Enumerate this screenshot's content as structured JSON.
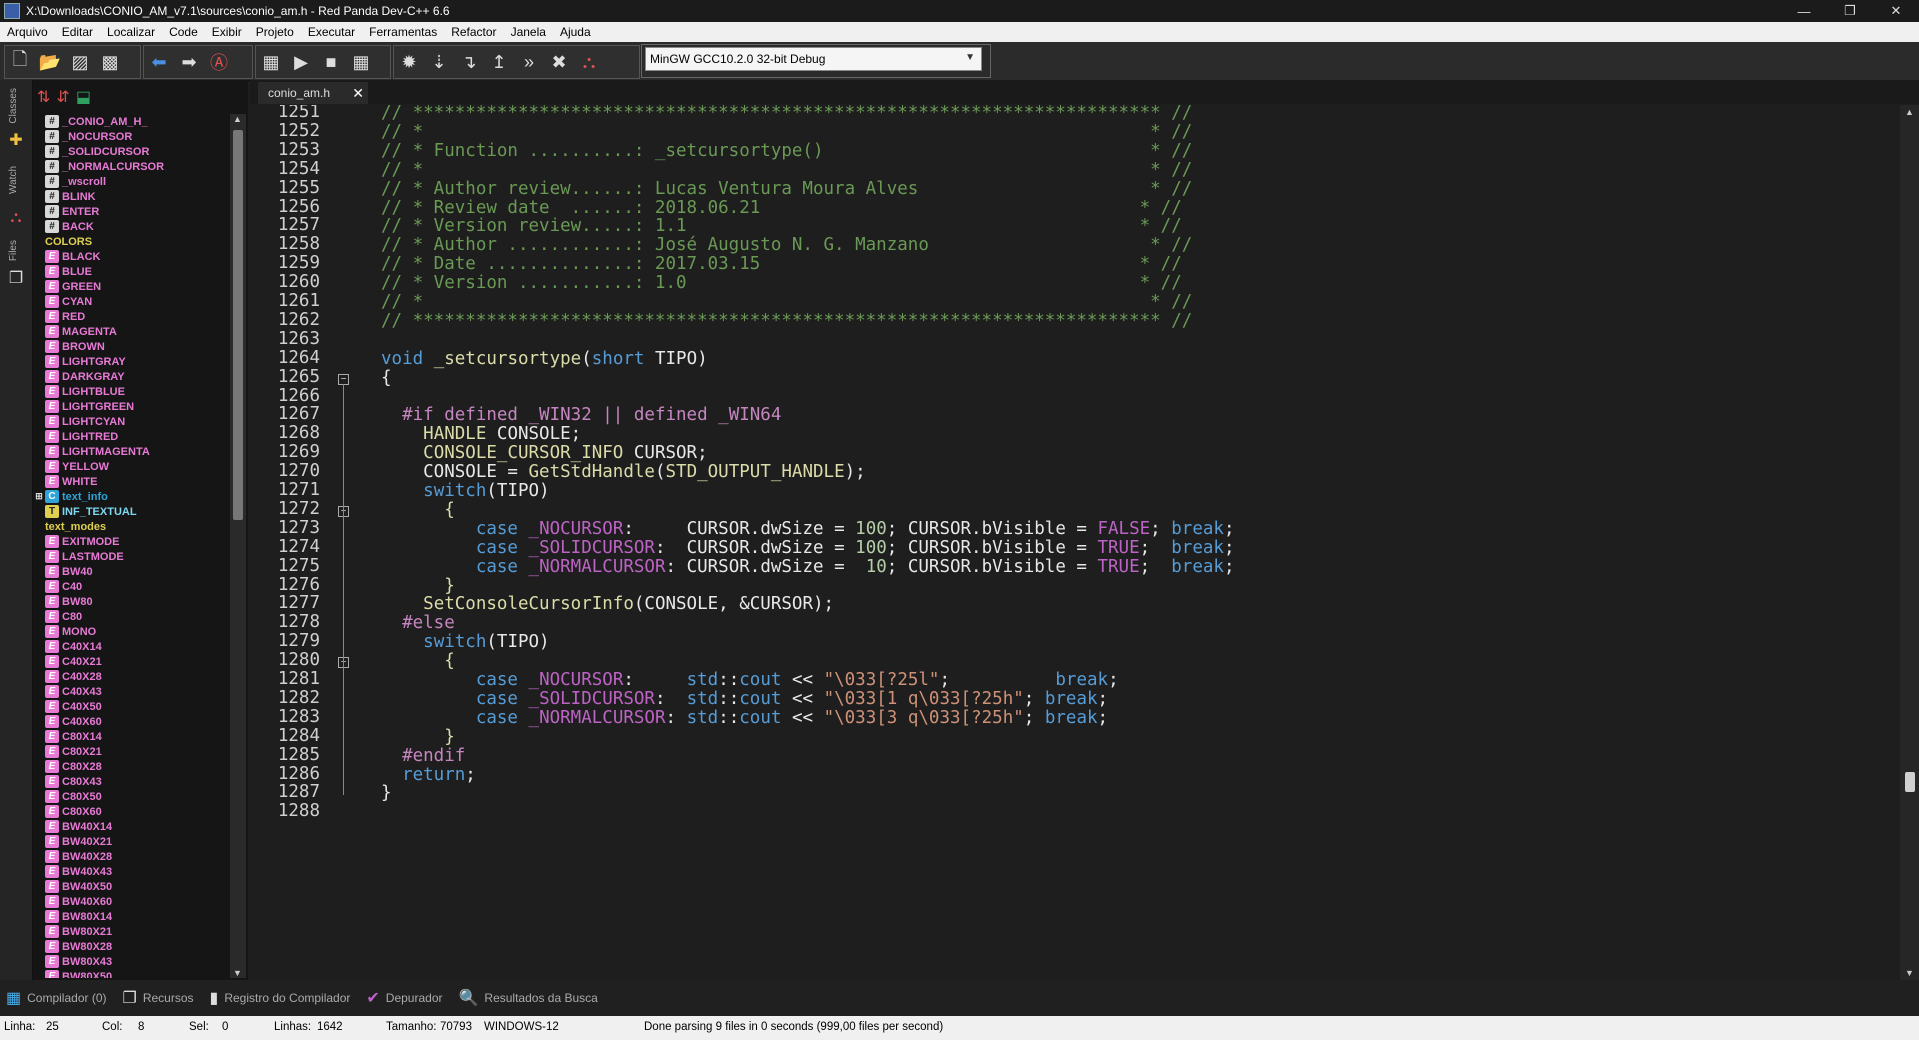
{
  "window": {
    "title": "X:\\Downloads\\CONIO_AM_v7.1\\sources\\conio_am.h - Red Panda Dev-C++ 6.6",
    "minimize": "—",
    "maximize": "❐",
    "close": "✕"
  },
  "menu": [
    "Arquivo",
    "Editar",
    "Localizar",
    "Code",
    "Exibir",
    "Projeto",
    "Executar",
    "Ferramentas",
    "Refactor",
    "Janela",
    "Ajuda"
  ],
  "compiler_select": {
    "value": "MinGW GCC10.2.0 32-bit Debug"
  },
  "side_tabs": {
    "classes": "Classes",
    "watch": "Watch",
    "files": "Files"
  },
  "tree_items": [
    {
      "label": "_CONIO_AM_H_",
      "icon": "hash",
      "color": "#e87ad6"
    },
    {
      "label": "_NOCURSOR",
      "icon": "hash",
      "color": "#e87ad6"
    },
    {
      "label": "_SOLIDCURSOR",
      "icon": "hash",
      "color": "#e87ad6"
    },
    {
      "label": "_NORMALCURSOR",
      "icon": "hash",
      "color": "#e87ad6"
    },
    {
      "label": "_wscroll",
      "icon": "hash",
      "color": "#e87ad6"
    },
    {
      "label": "BLINK",
      "icon": "hash",
      "color": "#e87ad6"
    },
    {
      "label": "ENTER",
      "icon": "hash",
      "color": "#e87ad6"
    },
    {
      "label": "BACK",
      "icon": "hash",
      "color": "#e87ad6"
    },
    {
      "label": "COLORS",
      "icon": "none",
      "color": "#e0d050"
    },
    {
      "label": "BLACK",
      "icon": "enum",
      "color": "#e87ad6"
    },
    {
      "label": "BLUE",
      "icon": "enum",
      "color": "#e87ad6"
    },
    {
      "label": "GREEN",
      "icon": "enum",
      "color": "#e87ad6"
    },
    {
      "label": "CYAN",
      "icon": "enum",
      "color": "#e87ad6"
    },
    {
      "label": "RED",
      "icon": "enum",
      "color": "#e87ad6"
    },
    {
      "label": "MAGENTA",
      "icon": "enum",
      "color": "#e87ad6"
    },
    {
      "label": "BROWN",
      "icon": "enum",
      "color": "#e87ad6"
    },
    {
      "label": "LIGHTGRAY",
      "icon": "enum",
      "color": "#e87ad6"
    },
    {
      "label": "DARKGRAY",
      "icon": "enum",
      "color": "#e87ad6"
    },
    {
      "label": "LIGHTBLUE",
      "icon": "enum",
      "color": "#e87ad6"
    },
    {
      "label": "LIGHTGREEN",
      "icon": "enum",
      "color": "#e87ad6"
    },
    {
      "label": "LIGHTCYAN",
      "icon": "enum",
      "color": "#e87ad6"
    },
    {
      "label": "LIGHTRED",
      "icon": "enum",
      "color": "#e87ad6"
    },
    {
      "label": "LIGHTMAGENTA",
      "icon": "enum",
      "color": "#e87ad6"
    },
    {
      "label": "YELLOW",
      "icon": "enum",
      "color": "#e87ad6"
    },
    {
      "label": "WHITE",
      "icon": "enum",
      "color": "#e87ad6"
    },
    {
      "label": "text_info",
      "icon": "struct",
      "color": "#2ea4d8",
      "expandable": true
    },
    {
      "label": "INF_TEXTUAL",
      "icon": "typedef",
      "color": "#7fd8f0"
    },
    {
      "label": "text_modes",
      "icon": "none",
      "color": "#e0d050"
    },
    {
      "label": "EXITMODE",
      "icon": "enum",
      "color": "#e87ad6"
    },
    {
      "label": "LASTMODE",
      "icon": "enum",
      "color": "#e87ad6"
    },
    {
      "label": "BW40",
      "icon": "enum",
      "color": "#e87ad6"
    },
    {
      "label": "C40",
      "icon": "enum",
      "color": "#e87ad6"
    },
    {
      "label": "BW80",
      "icon": "enum",
      "color": "#e87ad6"
    },
    {
      "label": "C80",
      "icon": "enum",
      "color": "#e87ad6"
    },
    {
      "label": "MONO",
      "icon": "enum",
      "color": "#e87ad6"
    },
    {
      "label": "C40X14",
      "icon": "enum",
      "color": "#e87ad6"
    },
    {
      "label": "C40X21",
      "icon": "enum",
      "color": "#e87ad6"
    },
    {
      "label": "C40X28",
      "icon": "enum",
      "color": "#e87ad6"
    },
    {
      "label": "C40X43",
      "icon": "enum",
      "color": "#e87ad6"
    },
    {
      "label": "C40X50",
      "icon": "enum",
      "color": "#e87ad6"
    },
    {
      "label": "C40X60",
      "icon": "enum",
      "color": "#e87ad6"
    },
    {
      "label": "C80X14",
      "icon": "enum",
      "color": "#e87ad6"
    },
    {
      "label": "C80X21",
      "icon": "enum",
      "color": "#e87ad6"
    },
    {
      "label": "C80X28",
      "icon": "enum",
      "color": "#e87ad6"
    },
    {
      "label": "C80X43",
      "icon": "enum",
      "color": "#e87ad6"
    },
    {
      "label": "C80X50",
      "icon": "enum",
      "color": "#e87ad6"
    },
    {
      "label": "C80X60",
      "icon": "enum",
      "color": "#e87ad6"
    },
    {
      "label": "BW40X14",
      "icon": "enum",
      "color": "#e87ad6"
    },
    {
      "label": "BW40X21",
      "icon": "enum",
      "color": "#e87ad6"
    },
    {
      "label": "BW40X28",
      "icon": "enum",
      "color": "#e87ad6"
    },
    {
      "label": "BW40X43",
      "icon": "enum",
      "color": "#e87ad6"
    },
    {
      "label": "BW40X50",
      "icon": "enum",
      "color": "#e87ad6"
    },
    {
      "label": "BW40X60",
      "icon": "enum",
      "color": "#e87ad6"
    },
    {
      "label": "BW80X14",
      "icon": "enum",
      "color": "#e87ad6"
    },
    {
      "label": "BW80X21",
      "icon": "enum",
      "color": "#e87ad6"
    },
    {
      "label": "BW80X28",
      "icon": "enum",
      "color": "#e87ad6"
    },
    {
      "label": "BW80X43",
      "icon": "enum",
      "color": "#e87ad6"
    },
    {
      "label": "BW80X50",
      "icon": "enum",
      "color": "#e87ad6"
    }
  ],
  "editor_tab": {
    "label": "conio_am.h"
  },
  "code_lines": [
    {
      "n": "1251",
      "segs": [
        [
          "cm",
          "// *********************************************************************** //"
        ]
      ]
    },
    {
      "n": "1252",
      "segs": [
        [
          "cm",
          "// *                                                                     * //"
        ]
      ]
    },
    {
      "n": "1253",
      "segs": [
        [
          "cm",
          "// * Function ..........: _setcursortype()                               * //"
        ]
      ]
    },
    {
      "n": "1254",
      "segs": [
        [
          "cm",
          "// *                                                                     * //"
        ]
      ]
    },
    {
      "n": "1255",
      "segs": [
        [
          "cm",
          "// * Author review......: Lucas Ventura Moura Alves                      * //"
        ]
      ]
    },
    {
      "n": "1256",
      "segs": [
        [
          "cm",
          "// * Review date  ......: 2018.06.21                                    * //"
        ]
      ]
    },
    {
      "n": "1257",
      "segs": [
        [
          "cm",
          "// * Version review.....: 1.1                                           * //"
        ]
      ]
    },
    {
      "n": "1258",
      "segs": [
        [
          "cm",
          "// * Author ............: José Augusto N. G. Manzano                     * //"
        ]
      ]
    },
    {
      "n": "1259",
      "segs": [
        [
          "cm",
          "// * Date ..............: 2017.03.15                                    * //"
        ]
      ]
    },
    {
      "n": "1260",
      "segs": [
        [
          "cm",
          "// * Version ...........: 1.0                                           * //"
        ]
      ]
    },
    {
      "n": "1261",
      "segs": [
        [
          "cm",
          "// *                                                                     * //"
        ]
      ]
    },
    {
      "n": "1262",
      "segs": [
        [
          "cm",
          "// *********************************************************************** //"
        ]
      ]
    },
    {
      "n": "1263",
      "segs": []
    },
    {
      "n": "1264",
      "segs": [
        [
          "kw",
          "void"
        ],
        [
          "tx",
          " "
        ],
        [
          "fn",
          "_setcursortype"
        ],
        [
          "tx",
          "("
        ],
        [
          "kw",
          "short"
        ],
        [
          "tx",
          " TIPO)"
        ]
      ]
    },
    {
      "n": "1265",
      "segs": [
        [
          "tx",
          "{"
        ]
      ],
      "fold": true
    },
    {
      "n": "1266",
      "segs": []
    },
    {
      "n": "1267",
      "segs": [
        [
          "tx",
          "  "
        ],
        [
          "pp",
          "#if defined _WIN32 || defined _WIN64"
        ]
      ]
    },
    {
      "n": "1268",
      "segs": [
        [
          "tx",
          "    "
        ],
        [
          "fn",
          "HANDLE"
        ],
        [
          "tx",
          " CONSOLE;"
        ]
      ]
    },
    {
      "n": "1269",
      "segs": [
        [
          "tx",
          "    "
        ],
        [
          "fn",
          "CONSOLE_CURSOR_INFO"
        ],
        [
          "tx",
          " CURSOR;"
        ]
      ]
    },
    {
      "n": "1270",
      "segs": [
        [
          "tx",
          "    CONSOLE = "
        ],
        [
          "fn",
          "GetStdHandle"
        ],
        [
          "tx",
          "("
        ],
        [
          "fn",
          "STD_OUTPUT_HANDLE"
        ],
        [
          "tx",
          ");"
        ]
      ]
    },
    {
      "n": "1271",
      "segs": [
        [
          "tx",
          "    "
        ],
        [
          "kw",
          "switch"
        ],
        [
          "tx",
          "(TIPO)"
        ]
      ]
    },
    {
      "n": "1272",
      "segs": [
        [
          "tx",
          "      "
        ],
        [
          "fn",
          "{"
        ]
      ],
      "fold": true
    },
    {
      "n": "1273",
      "segs": [
        [
          "tx",
          "         "
        ],
        [
          "kw",
          "case"
        ],
        [
          "tx",
          " "
        ],
        [
          "mc",
          "_NOCURSOR"
        ],
        [
          "tx",
          ":     CURSOR.dwSize = "
        ],
        [
          "num",
          "100"
        ],
        [
          "tx",
          "; CURSOR.bVisible = "
        ],
        [
          "mc",
          "FALSE"
        ],
        [
          "tx",
          "; "
        ],
        [
          "kw",
          "break"
        ],
        [
          "tx",
          ";"
        ]
      ]
    },
    {
      "n": "1274",
      "segs": [
        [
          "tx",
          "         "
        ],
        [
          "kw",
          "case"
        ],
        [
          "tx",
          " "
        ],
        [
          "mc",
          "_SOLIDCURSOR"
        ],
        [
          "tx",
          ":  CURSOR.dwSize = "
        ],
        [
          "num",
          "100"
        ],
        [
          "tx",
          "; CURSOR.bVisible = "
        ],
        [
          "mc",
          "TRUE"
        ],
        [
          "tx",
          ";  "
        ],
        [
          "kw",
          "break"
        ],
        [
          "tx",
          ";"
        ]
      ]
    },
    {
      "n": "1275",
      "segs": [
        [
          "tx",
          "         "
        ],
        [
          "kw",
          "case"
        ],
        [
          "tx",
          " "
        ],
        [
          "mc",
          "_NORMALCURSOR"
        ],
        [
          "tx",
          ": CURSOR.dwSize =  "
        ],
        [
          "num",
          "10"
        ],
        [
          "tx",
          "; CURSOR.bVisible = "
        ],
        [
          "mc",
          "TRUE"
        ],
        [
          "tx",
          ";  "
        ],
        [
          "kw",
          "break"
        ],
        [
          "tx",
          ";"
        ]
      ]
    },
    {
      "n": "1276",
      "segs": [
        [
          "tx",
          "      "
        ],
        [
          "fn",
          "}"
        ]
      ]
    },
    {
      "n": "1277",
      "segs": [
        [
          "tx",
          "    "
        ],
        [
          "fn",
          "SetConsoleCursorInfo"
        ],
        [
          "tx",
          "(CONSOLE, &CURSOR);"
        ]
      ]
    },
    {
      "n": "1278",
      "segs": [
        [
          "tx",
          "  "
        ],
        [
          "pp",
          "#else"
        ]
      ]
    },
    {
      "n": "1279",
      "segs": [
        [
          "tx",
          "    "
        ],
        [
          "kw",
          "switch"
        ],
        [
          "tx",
          "(TIPO)"
        ]
      ]
    },
    {
      "n": "1280",
      "segs": [
        [
          "tx",
          "      "
        ],
        [
          "fn",
          "{"
        ]
      ],
      "fold": true
    },
    {
      "n": "1281",
      "segs": [
        [
          "tx",
          "         "
        ],
        [
          "kw",
          "case"
        ],
        [
          "tx",
          " "
        ],
        [
          "mc",
          "_NOCURSOR"
        ],
        [
          "tx",
          ":     "
        ],
        [
          "kw",
          "std"
        ],
        [
          "tx",
          "::"
        ],
        [
          "kw",
          "cout"
        ],
        [
          "tx",
          " << "
        ],
        [
          "str",
          "\"\\033[?25l\""
        ],
        [
          "tx",
          ";          "
        ],
        [
          "kw",
          "break"
        ],
        [
          "tx",
          ";"
        ]
      ]
    },
    {
      "n": "1282",
      "segs": [
        [
          "tx",
          "         "
        ],
        [
          "kw",
          "case"
        ],
        [
          "tx",
          " "
        ],
        [
          "mc",
          "_SOLIDCURSOR"
        ],
        [
          "tx",
          ":  "
        ],
        [
          "kw",
          "std"
        ],
        [
          "tx",
          "::"
        ],
        [
          "kw",
          "cout"
        ],
        [
          "tx",
          " << "
        ],
        [
          "str",
          "\"\\033[1 q\\033[?25h\""
        ],
        [
          "tx",
          "; "
        ],
        [
          "kw",
          "break"
        ],
        [
          "tx",
          ";"
        ]
      ]
    },
    {
      "n": "1283",
      "segs": [
        [
          "tx",
          "         "
        ],
        [
          "kw",
          "case"
        ],
        [
          "tx",
          " "
        ],
        [
          "mc",
          "_NORMALCURSOR"
        ],
        [
          "tx",
          ": "
        ],
        [
          "kw",
          "std"
        ],
        [
          "tx",
          "::"
        ],
        [
          "kw",
          "cout"
        ],
        [
          "tx",
          " << "
        ],
        [
          "str",
          "\"\\033[3 q\\033[?25h\""
        ],
        [
          "tx",
          "; "
        ],
        [
          "kw",
          "break"
        ],
        [
          "tx",
          ";"
        ]
      ]
    },
    {
      "n": "1284",
      "segs": [
        [
          "tx",
          "      "
        ],
        [
          "fn",
          "}"
        ]
      ]
    },
    {
      "n": "1285",
      "segs": [
        [
          "tx",
          "  "
        ],
        [
          "pp",
          "#endif"
        ]
      ]
    },
    {
      "n": "1286",
      "segs": [
        [
          "tx",
          "  "
        ],
        [
          "kw",
          "return"
        ],
        [
          "tx",
          ";"
        ]
      ]
    },
    {
      "n": "1287",
      "segs": [
        [
          "tx",
          "}"
        ]
      ]
    },
    {
      "n": "1288",
      "segs": []
    }
  ],
  "bottom_tabs": [
    {
      "label": "Compilador (0)",
      "icon": "grid-icon"
    },
    {
      "label": "Recursos",
      "icon": "resources-icon"
    },
    {
      "label": "Registro do Compilador",
      "icon": "bar-chart-icon"
    },
    {
      "label": "Depurador",
      "icon": "check-icon"
    },
    {
      "label": "Resultados da Busca",
      "icon": "search-results-icon"
    }
  ],
  "status": {
    "linha_label": "Linha:",
    "linha": "25",
    "col_label": "Col:",
    "col": "8",
    "sel_label": "Sel:",
    "sel": "0",
    "linhas_label": "Linhas:",
    "linhas": "1642",
    "tamanho_label": "Tamanho:",
    "tamanho": "70793",
    "encoding": "WINDOWS-12",
    "message": "Done parsing 9 files in 0 seconds (999,00 files per second)"
  }
}
